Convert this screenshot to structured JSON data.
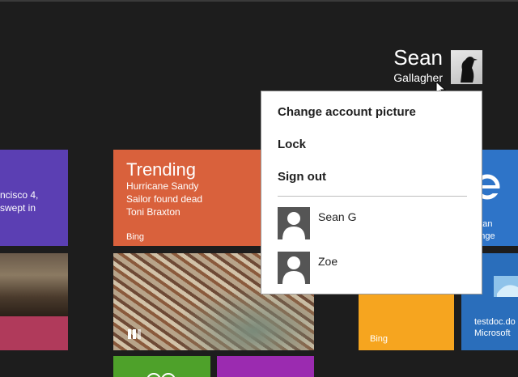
{
  "user": {
    "first_name": "Sean",
    "last_name": "Gallagher"
  },
  "menu": {
    "items": [
      {
        "label": "Change account picture"
      },
      {
        "label": "Lock"
      },
      {
        "label": "Sign out"
      }
    ],
    "accounts": [
      {
        "name": "Sean G"
      },
      {
        "name": "Zoe"
      }
    ]
  },
  "tiles": {
    "news_left": {
      "line1": "ncisco 4,",
      "line2": "swept in"
    },
    "trending": {
      "title": "Trending",
      "items": [
        "Hurricane Sandy",
        "Sailor found dead",
        "Toni Braxton"
      ],
      "source": "Bing"
    },
    "messaging": {
      "line1": "o instan",
      "line2": "essenge"
    },
    "orange": {
      "label": "Bing"
    },
    "desktop": {
      "line1": "testdoc.do",
      "line2": "Microsoft"
    }
  },
  "colors": {
    "background": "#1d1d1d",
    "purple": "#5b3fb3",
    "trending": "#d9613c",
    "orange": "#f6a51f",
    "blue": "#2e74c8",
    "green": "#4ea12a",
    "magenta": "#9b2bb0"
  },
  "icons": [
    "ie-icon",
    "cursor-icon",
    "user-silhouette-icon",
    "ring-icon",
    "paging-icon"
  ]
}
